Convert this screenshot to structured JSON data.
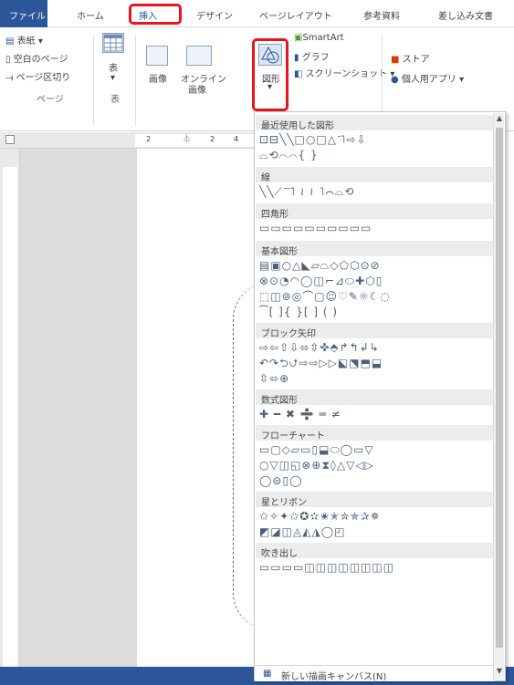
{
  "tabs": {
    "file": "ファイル",
    "home": "ホーム",
    "insert": "挿入",
    "design": "デザイン",
    "layout": "ページレイアウト",
    "references": "参考資料",
    "mailings": "差し込み文書"
  },
  "ribbon": {
    "cover": "表紙 ▾",
    "blank": "空白のページ",
    "pagebreak": "ページ区切り",
    "group_pages": "ページ",
    "table": "表",
    "table_arrow": "▾",
    "group_table": "表",
    "image": "画像",
    "online_line1": "オンライン",
    "online_line2": "画像",
    "shapes": "図形",
    "shapes_arrow": "▾",
    "smartart": "SmartArt",
    "graph": "グラフ",
    "screenshot": "スクリーンショット ▾",
    "store": "ストア",
    "personal_apps": "個人用アプリ ▾"
  },
  "ruler": {
    "tick1": "2",
    "tick2": "2",
    "tick3": "4"
  },
  "dropdown": {
    "categories": [
      "最近使用した図形",
      "線",
      "四角形",
      "基本図形",
      "ブロック矢印",
      "数式図形",
      "フローチャート",
      "星とリボン",
      "吹き出し"
    ],
    "rows": {
      "recent": [
        "⊡⊟╲╲□○□△˥˥⇨⇩",
        "⌓⟲⌒⌒{ }"
      ],
      "lines": [
        "╲╲⟋˥˥˥ ≀ ≀ ˥⌒⌓⟲"
      ],
      "rects": [
        "▭▭▭▭▭▭▭▭▭▭"
      ],
      "basic": [
        "▤▣○△◣▱⏢◇⬠⬡⊙⊘",
        "⊗⊙◔◠◯◫⌐⊿⬭✚⬡▯",
        "⬚◫⊚◎⌒▢☺♡✎☼☾◌",
        "⁀[ ]{ }[ ] ( )"
      ],
      "block": [
        "⇨⇦⇧⇩⬄⇳✜⬘↱↰↲↳",
        "↶↷⮌⮍⇨⇨▷▷⬕⬔⬒⬓",
        "⇳⬄⊕"
      ],
      "math": [
        "✚ ━ ✖ ➗ ═ ≠"
      ],
      "flow": [
        "▭▢◇▱▭▯⬓⬭◯▭▽",
        "○▽◫◱⊗⊕⧗◊△▽◁▷",
        "◯⊜▯◯"
      ],
      "stars": [
        "✩✧✦✩✪✫✬✭✮✯✰✵",
        "◩◪◫◬◭◮◯◰"
      ],
      "callouts": [
        "▭▭▭▭◫◫◫◫◫◫◫◫"
      ]
    },
    "footer_text": "新しい描画キャンバス(N)"
  }
}
